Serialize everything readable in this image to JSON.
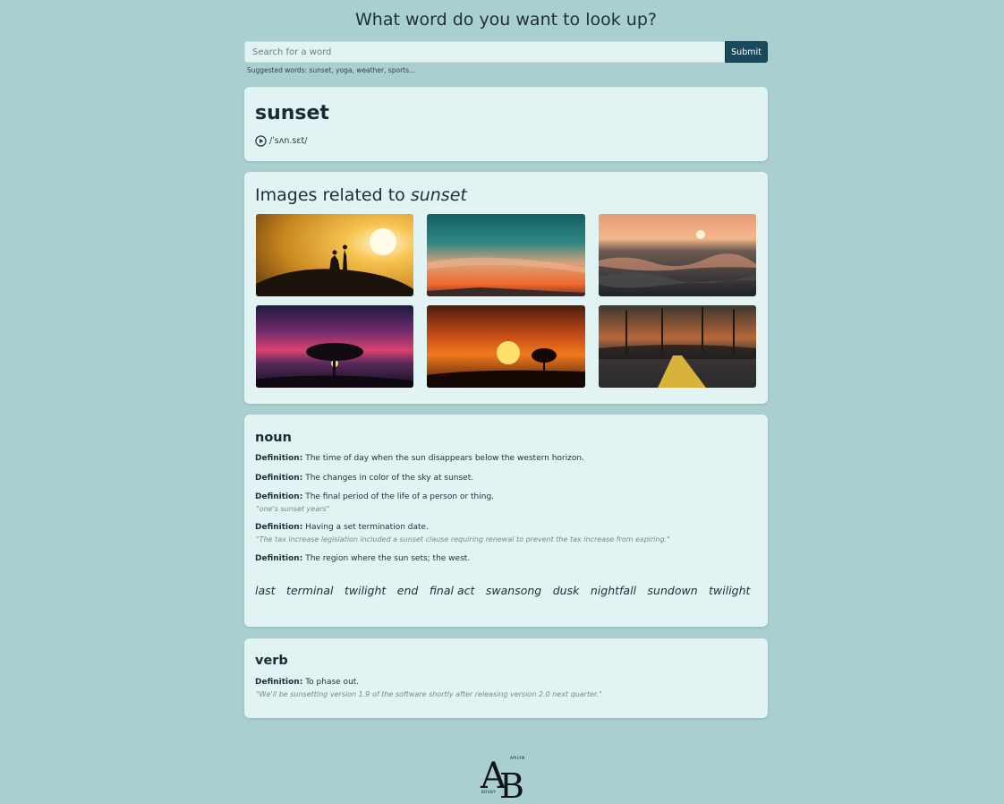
{
  "header": {
    "question": "What word do you want to look up?"
  },
  "search": {
    "placeholder": "Search for a word",
    "submit_label": "Submit",
    "suggestions": "Suggested words: sunset, yoga, weather, sports..."
  },
  "word_card": {
    "word": "sunset",
    "phonetic": "/ˈsʌn.sɛt/",
    "play_icon": "play-circle-icon"
  },
  "images": {
    "title_prefix": "Images related to",
    "title_word": "sunset",
    "count": 6
  },
  "noun": {
    "part_of_speech": "noun",
    "definition_label": "Definition:",
    "definitions": [
      {
        "text": "The time of day when the sun disappears below the western horizon.",
        "example": ""
      },
      {
        "text": "The changes in color of the sky at sunset.",
        "example": ""
      },
      {
        "text": "The final period of the life of a person or thing.",
        "example": "\"one's sunset years\""
      },
      {
        "text": "Having a set termination date.",
        "example": "\"The tax increase legislation included a sunset clause requiring renewal to prevent the tax increase from expiring.\""
      },
      {
        "text": "The region where the sun sets; the west.",
        "example": ""
      }
    ],
    "synonyms": [
      "last",
      "terminal",
      "twilight",
      "end",
      "final act",
      "swansong",
      "dusk",
      "nightfall",
      "sundown",
      "twilight"
    ]
  },
  "verb": {
    "part_of_speech": "verb",
    "definition_label": "Definition:",
    "definitions": [
      {
        "text": "To phase out.",
        "example": "\"We'll be sunsetting version 1.9 of the software shortly after releasing version 2.0 next quarter.\""
      }
    ]
  },
  "footer": {
    "logo_letters": "AB",
    "logo_small_top": "APILYN",
    "logo_small_bottom": "BOSNY"
  },
  "colors": {
    "background": "#a9cfd0",
    "card": "#e2f3f3",
    "button": "#174a5c"
  }
}
